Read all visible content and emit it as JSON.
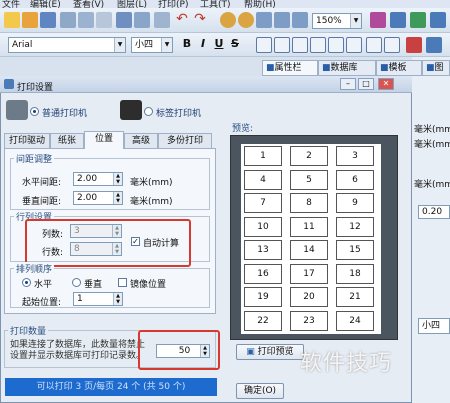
{
  "menu": [
    "文件",
    "编辑(E)",
    "查看(V)",
    "图层(L)",
    "打印(P)",
    "工具(T)",
    "帮助(H)"
  ],
  "toolbar": {
    "zoom": "150%",
    "font_name": "Arial",
    "font_size": "小四",
    "bold": "B",
    "italic": "I",
    "underline": "U",
    "strike": "S"
  },
  "right_tabs": {
    "properties": "属性栏",
    "database": "数据库",
    "template": "模板",
    "image": "图"
  },
  "right_pane": {
    "unit1": "毫米(mm)",
    "unit2": "毫米(mm)",
    "unit3": "毫米(mm)",
    "val1": "0.20",
    "size": "小四"
  },
  "dialog": {
    "title": "打印设置",
    "printer_normal": "普通打印机",
    "printer_label": "标签打印机",
    "tabs": [
      "打印驱动",
      "纸张",
      "位置",
      "高级",
      "多份打印"
    ],
    "active_tab": 2,
    "spacing_section": "间距调整",
    "h_spacing_label": "水平间距:",
    "h_spacing_value": "2.00",
    "h_spacing_unit": "毫米(mm)",
    "v_spacing_label": "垂直间距:",
    "v_spacing_value": "2.00",
    "v_spacing_unit": "毫米(mm)",
    "rowcol_section": "行列设置",
    "cols_label": "列数:",
    "cols_value": "3",
    "rows_label": "行数:",
    "rows_value": "8",
    "auto_calc_label": "自动计算",
    "order_section": "排列顺序",
    "horizontal": "水平",
    "vertical": "垂直",
    "mirror": "镜像位置",
    "start_pos_label": "起始位置:",
    "start_pos_value": "1",
    "print_count_section": "打印数量",
    "print_count_note": "如果连接了数据库，此数量将禁止设置并显示数据库可打印记录数。",
    "print_count_value": "50",
    "status": "可以打印 3 页/每页 24 个 (共 50 个)",
    "preview_label": "预览:",
    "preview_cells": [
      "1",
      "2",
      "3",
      "4",
      "5",
      "6",
      "7",
      "8",
      "9",
      "10",
      "11",
      "12",
      "13",
      "14",
      "15",
      "16",
      "17",
      "18",
      "19",
      "20",
      "21",
      "22",
      "23",
      "24"
    ],
    "preview_button": "打印预览",
    "ok_button": "确定(O)"
  },
  "watermark": "软件技巧"
}
